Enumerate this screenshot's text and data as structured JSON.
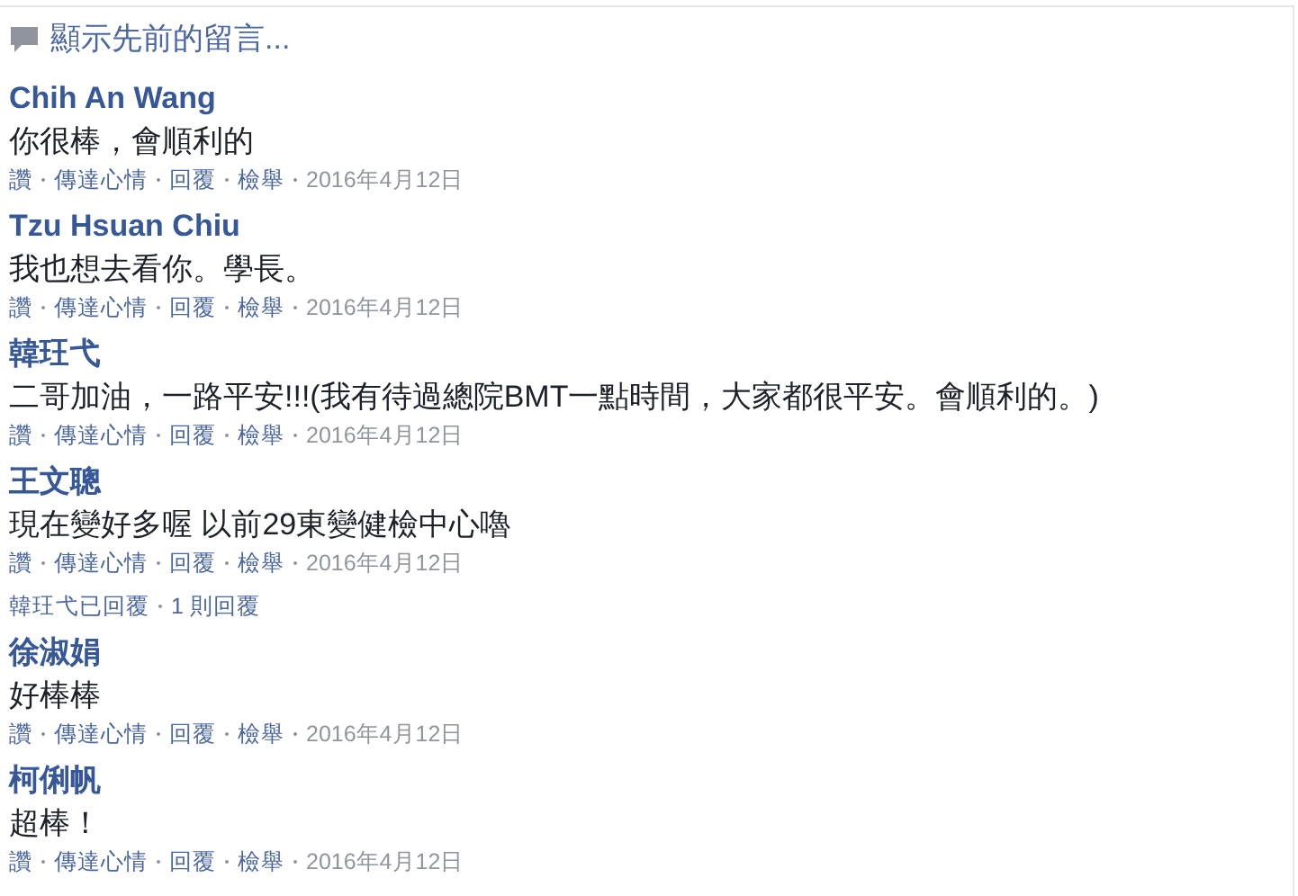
{
  "header": {
    "text": "顯示先前的留言..."
  },
  "comments": [
    {
      "name": "Chih An Wang",
      "text": "你很棒，會順利的",
      "actions": [
        "讚",
        "傳達心情",
        "回覆",
        "檢舉"
      ],
      "date": "2016年4月12日"
    },
    {
      "name": "Tzu Hsuan Chiu",
      "text": "我也想去看你。學長。",
      "actions": [
        "讚",
        "傳達心情",
        "回覆",
        "檢舉"
      ],
      "date": "2016年4月12日"
    },
    {
      "name": "韓玨弋",
      "text": "二哥加油，一路平安!!!(我有待過總院BMT一點時間，大家都很平安。會順利的。)",
      "actions": [
        "讚",
        "傳達心情",
        "回覆",
        "檢舉"
      ],
      "date": "2016年4月12日"
    },
    {
      "name": "王文聰",
      "text": "現在變好多喔 以前29東變健檢中心嚕",
      "actions": [
        "讚",
        "傳達心情",
        "回覆",
        "檢舉"
      ],
      "date": "2016年4月12日",
      "replies": {
        "who": "韓玨弋已回覆",
        "count": "1 則回覆"
      }
    },
    {
      "name": "徐淑娟",
      "text": "好棒棒",
      "actions": [
        "讚",
        "傳達心情",
        "回覆",
        "檢舉"
      ],
      "date": "2016年4月12日"
    },
    {
      "name": "柯俐帆",
      "text": "超棒！",
      "actions": [
        "讚",
        "傳達心情",
        "回覆",
        "檢舉"
      ],
      "date": "2016年4月12日"
    }
  ]
}
